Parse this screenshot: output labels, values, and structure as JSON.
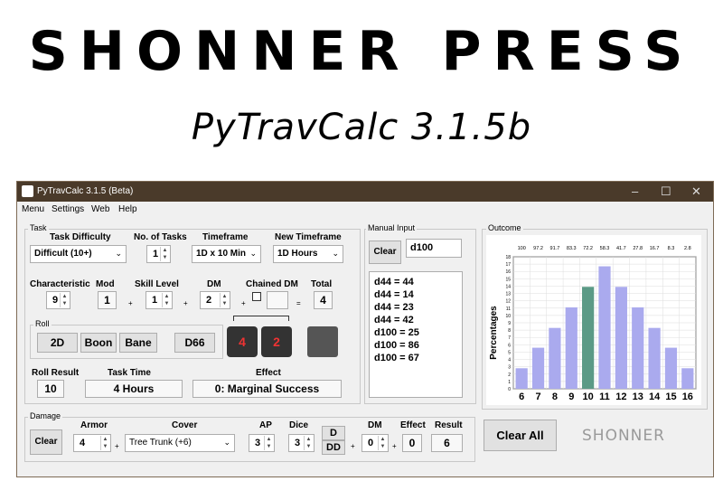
{
  "banner": {
    "brand": "SHONNER PRESS",
    "subtitle": "PyTravCalc 3.1.5b"
  },
  "window": {
    "title": "PyTravCalc 3.1.5 (Beta)",
    "controls": [
      "–",
      "☐",
      "✕"
    ]
  },
  "menu": [
    "Menu",
    "Settings",
    "Web",
    "Help"
  ],
  "task": {
    "group_label": "Task",
    "difficulty": {
      "label": "Task Difficulty",
      "value": "Difficult (10+)"
    },
    "num_tasks": {
      "label": "No. of Tasks",
      "value": "1"
    },
    "timeframe": {
      "label": "Timeframe",
      "value": "1D x 10 Min"
    },
    "new_timeframe": {
      "label": "New Timeframe",
      "value": "1D Hours"
    },
    "characteristic": {
      "label": "Characteristic",
      "value": "9"
    },
    "mod": {
      "label": "Mod",
      "value": "1"
    },
    "skill_level": {
      "label": "Skill Level",
      "value": "1"
    },
    "dm": {
      "label": "DM",
      "value": "2"
    },
    "chained_dm": {
      "label": "Chained DM",
      "value": ""
    },
    "total": {
      "label": "Total",
      "value": "4"
    },
    "ops": [
      "+",
      "+",
      "+",
      "="
    ],
    "roll": {
      "label": "Roll",
      "buttons": [
        "2D",
        "Boon",
        "Bane",
        "D66"
      ]
    },
    "roll_result": {
      "label": "Roll Result",
      "value": "10"
    },
    "task_time": {
      "label": "Task Time",
      "value": "4 Hours"
    },
    "effect": {
      "label": "Effect",
      "value": "0: Marginal Success"
    }
  },
  "dice": [
    "4",
    "2"
  ],
  "manual": {
    "group_label": "Manual Input",
    "clear_label": "Clear",
    "input_value": "d100",
    "log": [
      "d44 = 44",
      "d44 = 14",
      "d44 = 23",
      "d44 = 42",
      "d100 = 25",
      "d100 = 86",
      "d100 = 67"
    ]
  },
  "damage": {
    "group_label": "Damage",
    "clear_label": "Clear",
    "armor": {
      "label": "Armor",
      "value": "4"
    },
    "cover": {
      "label": "Cover",
      "value": "Tree Trunk (+6)"
    },
    "ap": {
      "label": "AP",
      "value": "3"
    },
    "dice_count": {
      "label": "Dice",
      "value": "3"
    },
    "d_button": "D",
    "dd_button": "DD",
    "dm": {
      "label": "DM",
      "value": "0"
    },
    "effect": {
      "label": "Effect",
      "value": "0"
    },
    "result": {
      "label": "Result",
      "value": "6"
    },
    "ops": [
      "+",
      "+",
      "+"
    ]
  },
  "outcome": {
    "group_label": "Outcome",
    "clear_all": "Clear All",
    "logo": "SHONNER"
  },
  "colors": {
    "bar": "#aaaaee",
    "highlight": "#5b9a86",
    "titlebar": "#4a3a2a"
  },
  "chart_data": {
    "type": "bar",
    "categories": [
      "6",
      "7",
      "8",
      "9",
      "10",
      "11",
      "12",
      "13",
      "14",
      "15",
      "16"
    ],
    "values": [
      2.8,
      5.6,
      8.3,
      11.1,
      13.9,
      16.7,
      13.9,
      11.1,
      8.3,
      5.6,
      2.8
    ],
    "top_labels": [
      "100",
      "97.2",
      "91.7",
      "83.3",
      "72.2",
      "58.3",
      "41.7",
      "27.8",
      "16.7",
      "8.3",
      "2.8"
    ],
    "highlight_category": "10",
    "ylabel": "Percentages",
    "yticks": [
      "0",
      "1",
      "2",
      "3",
      "4",
      "5",
      "6",
      "7",
      "8",
      "9",
      "10",
      "11",
      "12",
      "13",
      "14",
      "15",
      "16",
      "17",
      "18"
    ],
    "ylim": [
      0,
      18
    ],
    "grid": true
  }
}
